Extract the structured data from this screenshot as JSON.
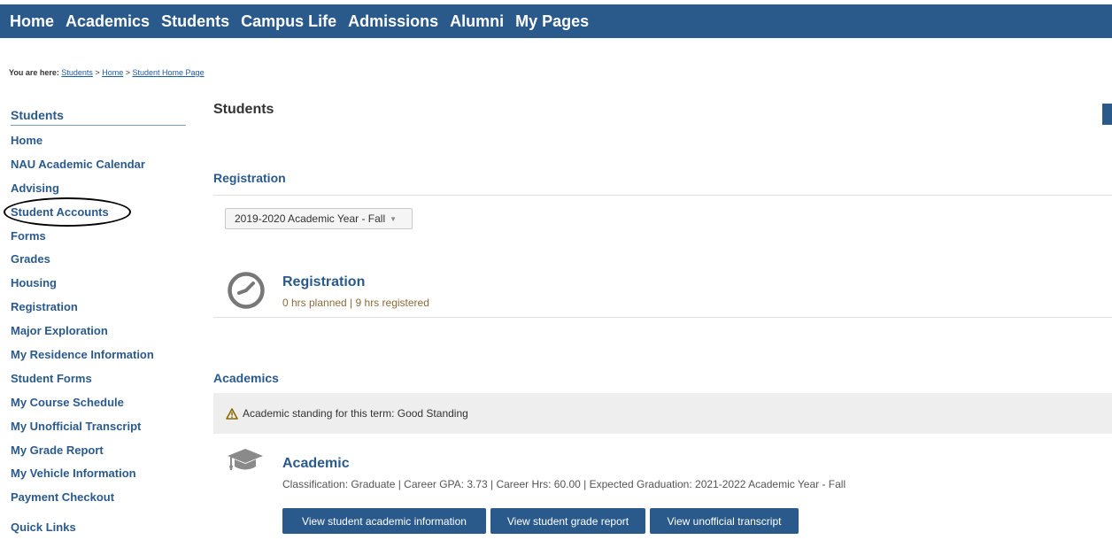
{
  "topnav": {
    "items": [
      "Home",
      "Academics",
      "Students",
      "Campus Life",
      "Admissions",
      "Alumni",
      "My Pages"
    ]
  },
  "breadcrumb": {
    "lead": "You are here:",
    "links": [
      "Students",
      "Home",
      "Student Home Page"
    ],
    "separator": ">"
  },
  "sidebar": {
    "title": "Students",
    "items": [
      "Home",
      "NAU Academic Calendar",
      "Advising",
      "Student Accounts",
      "Forms",
      "Grades",
      "Housing",
      "Registration",
      "Major Exploration",
      "My Residence Information",
      "Student Forms",
      "My Course Schedule",
      "My Unofficial Transcript",
      "My Grade Report",
      "My Vehicle Information",
      "Payment Checkout"
    ],
    "quick_links": "Quick Links"
  },
  "main": {
    "title": "Students",
    "registration": {
      "heading": "Registration",
      "term_selected": "2019-2020 Academic Year - Fall",
      "card_title": "Registration",
      "card_summary": "0 hrs planned | 9 hrs registered",
      "icon": "clock-icon"
    },
    "academics": {
      "heading": "Academics",
      "standing": "Academic standing for this term: Good Standing",
      "card_title": "Academic",
      "card_summary": "Classification: Graduate | Career GPA: 3.73 | Career Hrs: 60.00 | Expected Graduation: 2021-2022 Academic Year - Fall",
      "icon": "graduation-cap-icon",
      "buttons": [
        "View student academic information",
        "View student grade report",
        "View unofficial transcript"
      ]
    }
  },
  "colors": {
    "brand": "#2a5a8c",
    "summary_text": "#8a6a3a",
    "standing_bg": "#eeeeee"
  }
}
